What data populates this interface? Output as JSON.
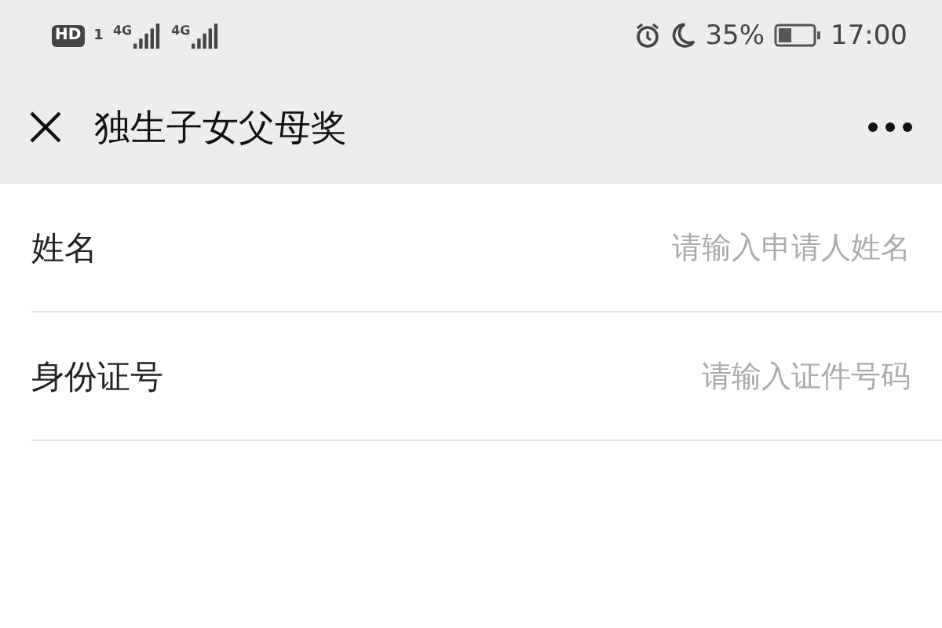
{
  "status_bar": {
    "badge": "HD",
    "sim": "1",
    "networks": [
      "4G",
      "4G"
    ],
    "battery_percent": "35%",
    "time": "17:00"
  },
  "header": {
    "title": "独生子女父母奖"
  },
  "fields": [
    {
      "label": "姓名",
      "placeholder": "请输入申请人姓名"
    },
    {
      "label": "身份证号",
      "placeholder": "请输入证件号码"
    }
  ]
}
